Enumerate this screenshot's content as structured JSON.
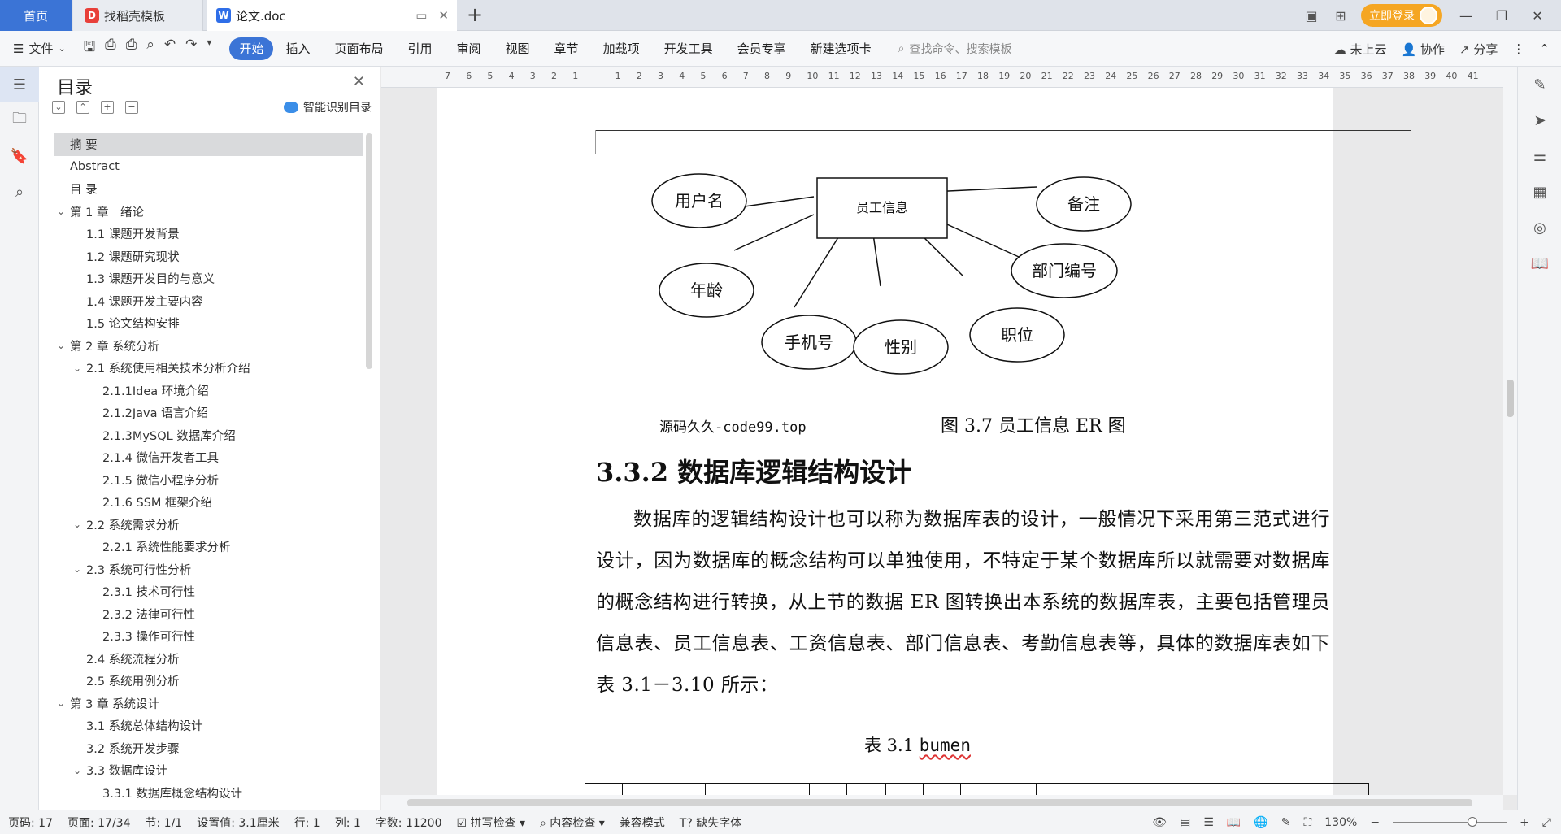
{
  "tabs": {
    "home": "首页",
    "docer": "找稻壳模板",
    "doc": "论文.doc"
  },
  "title_right": {
    "login": "立即登录"
  },
  "menu": {
    "file": "文件",
    "items": [
      "开始",
      "插入",
      "页面布局",
      "引用",
      "审阅",
      "视图",
      "章节",
      "加载项",
      "开发工具",
      "会员专享",
      "新建选项卡"
    ],
    "search_placeholder": "查找命令、搜索模板",
    "cloud": "未上云",
    "collab": "协作",
    "share": "分享"
  },
  "toc": {
    "title": "目录",
    "smart": "智能识别目录",
    "items": [
      {
        "label": "摘 要",
        "level": 0,
        "chevron": false,
        "selected": true
      },
      {
        "label": "Abstract",
        "level": 0,
        "chevron": false,
        "selected": false
      },
      {
        "label": "目 录",
        "level": 0,
        "chevron": false,
        "selected": false
      },
      {
        "label": "第 1 章　绪论",
        "level": 0,
        "chevron": true,
        "selected": false
      },
      {
        "label": "1.1 课题开发背景",
        "level": 1,
        "chevron": false,
        "selected": false
      },
      {
        "label": "1.2 课题研究现状",
        "level": 1,
        "chevron": false,
        "selected": false
      },
      {
        "label": "1.3 课题开发目的与意义",
        "level": 1,
        "chevron": false,
        "selected": false
      },
      {
        "label": "1.4 课题开发主要内容",
        "level": 1,
        "chevron": false,
        "selected": false
      },
      {
        "label": "1.5 论文结构安排",
        "level": 1,
        "chevron": false,
        "selected": false
      },
      {
        "label": "第 2 章  系统分析",
        "level": 0,
        "chevron": true,
        "selected": false
      },
      {
        "label": "2.1 系统使用相关技术分析介绍",
        "level": 1,
        "chevron": true,
        "selected": false
      },
      {
        "label": "2.1.1Idea 环境介绍",
        "level": 2,
        "chevron": false,
        "selected": false
      },
      {
        "label": "2.1.2Java 语言介绍",
        "level": 2,
        "chevron": false,
        "selected": false
      },
      {
        "label": " 2.1.3MySQL 数据库介绍",
        "level": 2,
        "chevron": false,
        "selected": false
      },
      {
        "label": "2.1.4 微信开发者工具",
        "level": 2,
        "chevron": false,
        "selected": false
      },
      {
        "label": "2.1.5 微信小程序分析",
        "level": 2,
        "chevron": false,
        "selected": false
      },
      {
        "label": "2.1.6 SSM 框架介绍",
        "level": 2,
        "chevron": false,
        "selected": false
      },
      {
        "label": "2.2 系统需求分析",
        "level": 1,
        "chevron": true,
        "selected": false
      },
      {
        "label": "2.2.1 系统性能要求分析",
        "level": 2,
        "chevron": false,
        "selected": false
      },
      {
        "label": "2.3 系统可行性分析",
        "level": 1,
        "chevron": true,
        "selected": false
      },
      {
        "label": "2.3.1 技术可行性",
        "level": 2,
        "chevron": false,
        "selected": false
      },
      {
        "label": "2.3.2 法律可行性",
        "level": 2,
        "chevron": false,
        "selected": false
      },
      {
        "label": "2.3.3 操作可行性",
        "level": 2,
        "chevron": false,
        "selected": false
      },
      {
        "label": "2.4 系统流程分析",
        "level": 1,
        "chevron": false,
        "selected": false
      },
      {
        "label": "2.5 系统用例分析",
        "level": 1,
        "chevron": false,
        "selected": false
      },
      {
        "label": "第 3 章  系统设计",
        "level": 0,
        "chevron": true,
        "selected": false
      },
      {
        "label": "3.1 系统总体结构设计",
        "level": 1,
        "chevron": false,
        "selected": false
      },
      {
        "label": "3.2 系统开发步骤",
        "level": 1,
        "chevron": false,
        "selected": false
      },
      {
        "label": "3.3 数据库设计",
        "level": 1,
        "chevron": true,
        "selected": false
      },
      {
        "label": "3.3.1 数据库概念结构设计",
        "level": 2,
        "chevron": false,
        "selected": false
      }
    ]
  },
  "ruler": [
    "7",
    "6",
    "5",
    "4",
    "3",
    "2",
    "1",
    "",
    "1",
    "2",
    "3",
    "4",
    "5",
    "6",
    "7",
    "8",
    "9",
    "10",
    "11",
    "12",
    "13",
    "14",
    "15",
    "16",
    "17",
    "18",
    "19",
    "20",
    "21",
    "22",
    "23",
    "24",
    "25",
    "26",
    "27",
    "28",
    "29",
    "30",
    "31",
    "32",
    "33",
    "34",
    "35",
    "36",
    "37",
    "38",
    "39",
    "40",
    "41"
  ],
  "document": {
    "er": {
      "entity": "员工信息",
      "attributes": [
        "用户名",
        "年龄",
        "手机号",
        "性别",
        "职位",
        "部门编号",
        "备注"
      ]
    },
    "watermark": "源码久久-code99.top",
    "figure_caption": "图 3.7 员工信息 ER 图",
    "heading": "3.3.2 数据库逻辑结构设计",
    "body": "数据库的逻辑结构设计也可以称为数据库表的设计，一般情况下采用第三范式进行设计，因为数据库的概念结构可以单独使用，不特定于某个数据库所以就需要对数据库的概念结构进行转换，从上节的数据 ER 图转换出本系统的数据库表，主要包括管理员信息表、员工信息表、工资信息表、部门信息表、考勤信息表等，具体的数据库表如下表 3.1－3.10 所示：",
    "table_caption_prefix": "表 3.1 ",
    "table_caption_name": "bumen"
  },
  "status": {
    "page_num": "页码: 17",
    "pages": "页面: 17/34",
    "section": "节: 1/1",
    "setting": "设置值: 3.1厘米",
    "row": "行: 1",
    "col": "列: 1",
    "words": "字数: 11200",
    "spell": "拼写检查",
    "content_check": "内容检查",
    "compat": "兼容模式",
    "missing_font": "缺失字体",
    "zoom": "130%"
  }
}
